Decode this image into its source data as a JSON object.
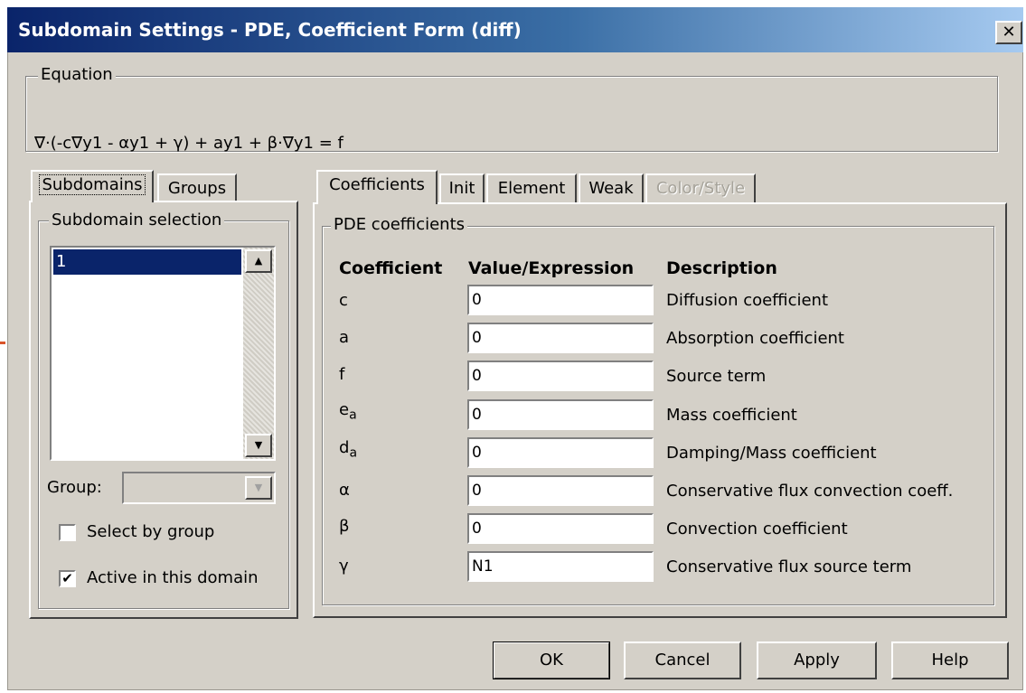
{
  "window": {
    "title": "Subdomain Settings - PDE, Coefficient Form (diff)",
    "close_label": "✕"
  },
  "equation": {
    "legend": "Equation",
    "text": "∇·(-c∇y1 - αy1 + γ) + ay1 + β·∇y1 = f"
  },
  "left_tabs": [
    {
      "label": "Subdomains",
      "active": true
    },
    {
      "label": "Groups",
      "active": false
    }
  ],
  "subdomain_selection": {
    "legend": "Subdomain selection",
    "items": [
      "1"
    ],
    "selected": "1",
    "group_label": "Group:",
    "group_value": "",
    "select_by_group": {
      "label": "Select by group",
      "checked": false
    },
    "active_in_domain": {
      "label": "Active in this domain",
      "checked": true
    }
  },
  "right_tabs": [
    {
      "label": "Coefficients",
      "active": true,
      "disabled": false
    },
    {
      "label": "Init",
      "active": false,
      "disabled": false
    },
    {
      "label": "Element",
      "active": false,
      "disabled": false
    },
    {
      "label": "Weak",
      "active": false,
      "disabled": false
    },
    {
      "label": "Color/Style",
      "active": false,
      "disabled": true
    }
  ],
  "pde": {
    "legend": "PDE coefficients",
    "headers": {
      "coefficient": "Coefficient",
      "value": "Value/Expression",
      "description": "Description"
    },
    "rows": [
      {
        "coef": "c",
        "sub": "",
        "value": "0",
        "description": "Diffusion coefficient"
      },
      {
        "coef": "a",
        "sub": "",
        "value": "0",
        "description": "Absorption coefficient"
      },
      {
        "coef": "f",
        "sub": "",
        "value": "0",
        "description": "Source term"
      },
      {
        "coef": "e",
        "sub": "a",
        "value": "0",
        "description": "Mass coefficient"
      },
      {
        "coef": "d",
        "sub": "a",
        "value": "0",
        "description": "Damping/Mass coefficient"
      },
      {
        "coef": "α",
        "sub": "",
        "value": "0",
        "description": "Conservative flux convection coeff."
      },
      {
        "coef": "β",
        "sub": "",
        "value": "0",
        "description": "Convection coefficient"
      },
      {
        "coef": "γ",
        "sub": "",
        "value": "N1",
        "description": "Conservative flux source term"
      }
    ]
  },
  "buttons": {
    "ok": "OK",
    "cancel": "Cancel",
    "apply": "Apply",
    "help": "Help"
  }
}
